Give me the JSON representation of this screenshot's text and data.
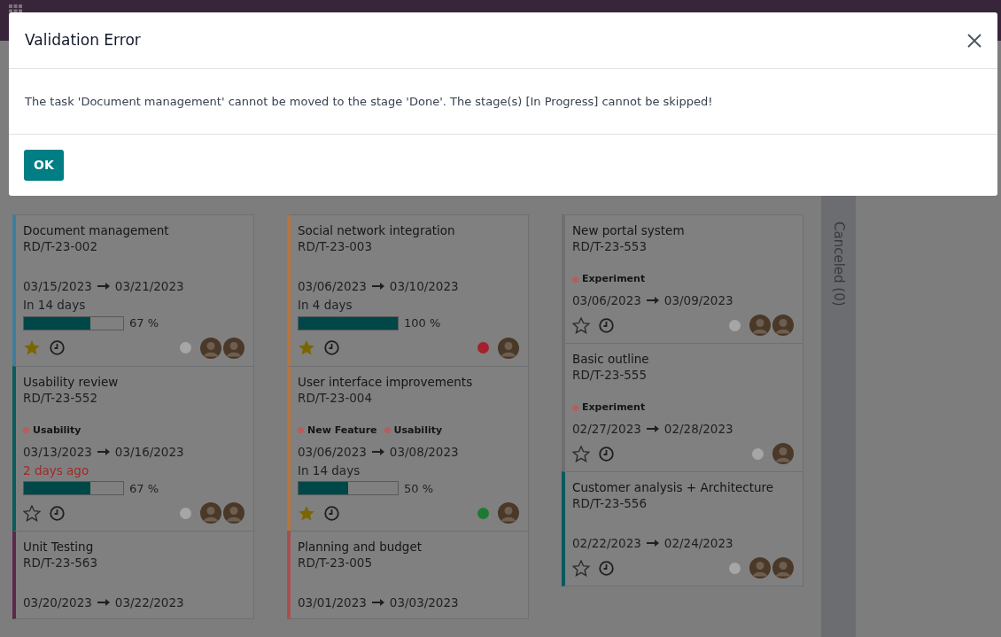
{
  "columns": [
    {
      "cards": [
        {
          "title": "Document management",
          "ref": "RD/T-23-002",
          "color": "#3f7d9c",
          "start": "03/15/2023",
          "end": "03/21/2023",
          "deadline": {
            "text": "In 14 days",
            "overdue": false
          },
          "progress": {
            "level": 0.67,
            "reading": "67 %"
          },
          "starred": true,
          "status": {
            "color": "#a4a6a8"
          },
          "assignees": [
            {
              "kind": "avatar"
            },
            {
              "kind": "avatar"
            }
          ]
        },
        {
          "title": "Usability review",
          "ref": "RD/T-23-552",
          "color": "#0b5a5e",
          "tags": [
            {
              "label": "Usability",
              "color": "#b85c5c"
            }
          ],
          "start": "03/13/2023",
          "end": "03/16/2023",
          "deadline": {
            "text": "2 days ago",
            "overdue": true
          },
          "progress": {
            "level": 0.67,
            "reading": "67 %"
          },
          "starred": false,
          "status": {
            "color": "#a4a6a8"
          },
          "assignees": [
            {
              "kind": "avatar"
            },
            {
              "kind": "avatar"
            }
          ]
        },
        {
          "title": "Unit Testing",
          "ref": "RD/T-23-563",
          "color": "#5a2a48",
          "start": "03/20/2023",
          "end": "03/22/2023"
        }
      ]
    },
    {
      "cards": [
        {
          "title": "Social network integration",
          "ref": "RD/T-23-003",
          "color": "#b8743c",
          "start": "03/06/2023",
          "end": "03/10/2023",
          "deadline": {
            "text": "In 4 days",
            "overdue": false
          },
          "progress": {
            "level": 1,
            "reading": "100 %"
          },
          "starred": true,
          "status": {
            "color": "#a3202c"
          },
          "assignees": [
            {
              "kind": "avatar"
            }
          ]
        },
        {
          "title": "User interface improvements",
          "ref": "RD/T-23-004",
          "color": "#b8743c",
          "tags": [
            {
              "label": "New Feature",
              "color": "#b85c5c"
            },
            {
              "label": "Usability",
              "color": "#b85c5c"
            }
          ],
          "start": "03/06/2023",
          "end": "03/08/2023",
          "deadline": {
            "text": "In 14 days",
            "overdue": false
          },
          "progress": {
            "level": 0.5,
            "reading": "50 %"
          },
          "starred": true,
          "status": {
            "color": "#1e7a32"
          },
          "assignees": [
            {
              "kind": "avatar"
            }
          ]
        },
        {
          "title": "Planning and budget",
          "ref": "RD/T-23-005",
          "color": "#a84e4e",
          "start": "03/01/2023",
          "end": "03/03/2023"
        }
      ]
    },
    {
      "cards": [
        {
          "title": "New portal system",
          "ref": "RD/T-23-553",
          "tags": [
            {
              "label": "Experiment",
              "color": "#b85c5c"
            }
          ],
          "start": "03/06/2023",
          "end": "03/09/2023",
          "starred": false,
          "status": {
            "color": "#a4a6a8"
          },
          "assignees": [
            {
              "kind": "avatar"
            },
            {
              "kind": "avatar"
            }
          ]
        },
        {
          "title": "Basic outline",
          "ref": "RD/T-23-555",
          "tags": [
            {
              "label": "Experiment",
              "color": "#b85c5c"
            }
          ],
          "start": "02/27/2023",
          "end": "02/28/2023",
          "starred": false,
          "status": {
            "color": "#a4a6a8"
          },
          "assignees": [
            {
              "kind": "avatar"
            }
          ]
        },
        {
          "title": "Customer analysis + Architecture",
          "ref": "RD/T-23-556",
          "color": "#0b5a5e",
          "start": "02/22/2023",
          "end": "02/24/2023",
          "starred": false,
          "status": {
            "color": "#a4a6a8"
          },
          "assignees": [
            {
              "kind": "avatar"
            },
            {
              "kind": "avatar"
            }
          ]
        }
      ]
    }
  ],
  "folded_column": {
    "label": "Canceled (0)"
  },
  "dialog": {
    "title": "Validation Error",
    "message": "The task 'Document management' cannot be moved to the stage 'Done'. The stage(s) [In Progress] cannot be skipped!",
    "buttons": [
      {
        "label": "OK"
      }
    ]
  }
}
